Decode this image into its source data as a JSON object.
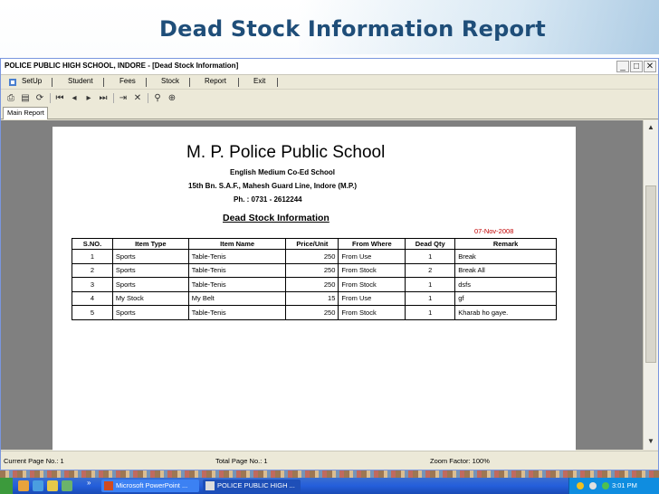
{
  "slide": {
    "title": "Dead Stock Information Report"
  },
  "window": {
    "title": "POLICE PUBLIC HIGH SCHOOL, INDORE - [Dead Stock Information]",
    "controls": {
      "minimize": "_",
      "maximize": "□",
      "close": "✕"
    }
  },
  "menu": {
    "items": [
      "SetUp",
      "Student",
      "Fees",
      "Stock",
      "Report",
      "Exit"
    ],
    "separator": "|"
  },
  "toolbar": {
    "icons": [
      "print-icon",
      "export-icon",
      "refresh-icon",
      "first-page-icon",
      "prev-page-icon",
      "next-page-icon",
      "last-page-icon",
      "goto-page-icon",
      "stop-icon",
      "search-icon",
      "zoom-icon"
    ]
  },
  "tabs": {
    "main": "Main Report"
  },
  "report": {
    "school": "M. P. Police Public School",
    "subtitle1": "English Medium Co-Ed School",
    "subtitle2": "15th Bn. S.A.F., Mahesh Guard Line, Indore (M.P.)",
    "phone": "Ph. : 0731 - 2612244",
    "heading": "Dead Stock Information",
    "date": "07-Nov-2008",
    "columns": [
      "S.NO.",
      "Item Type",
      "Item Name",
      "Price/Unit",
      "From Where",
      "Dead Qty",
      "Remark"
    ],
    "rows": [
      [
        "1",
        "Sports",
        "Table-Tenis",
        "250",
        "From Use",
        "1",
        "Break"
      ],
      [
        "2",
        "Sports",
        "Table-Tenis",
        "250",
        "From Stock",
        "2",
        "Break All"
      ],
      [
        "3",
        "Sports",
        "Table-Tenis",
        "250",
        "From Stock",
        "1",
        "dsfs"
      ],
      [
        "4",
        "My Stock",
        "My Belt",
        "15",
        "From Use",
        "1",
        "gf"
      ],
      [
        "5",
        "Sports",
        "Table-Tenis",
        "250",
        "From Stock",
        "1",
        "Kharab ho gaye."
      ]
    ]
  },
  "status": {
    "current_page": "Current Page No.: 1",
    "total_page": "Total Page No.: 1",
    "zoom": "Zoom Factor: 100%"
  },
  "taskbar": {
    "powerpoint": "Microsoft PowerPoint ...",
    "app": "POLICE PUBLIC HIGH ...",
    "clock": "3:01 PM",
    "overflow": "»"
  }
}
